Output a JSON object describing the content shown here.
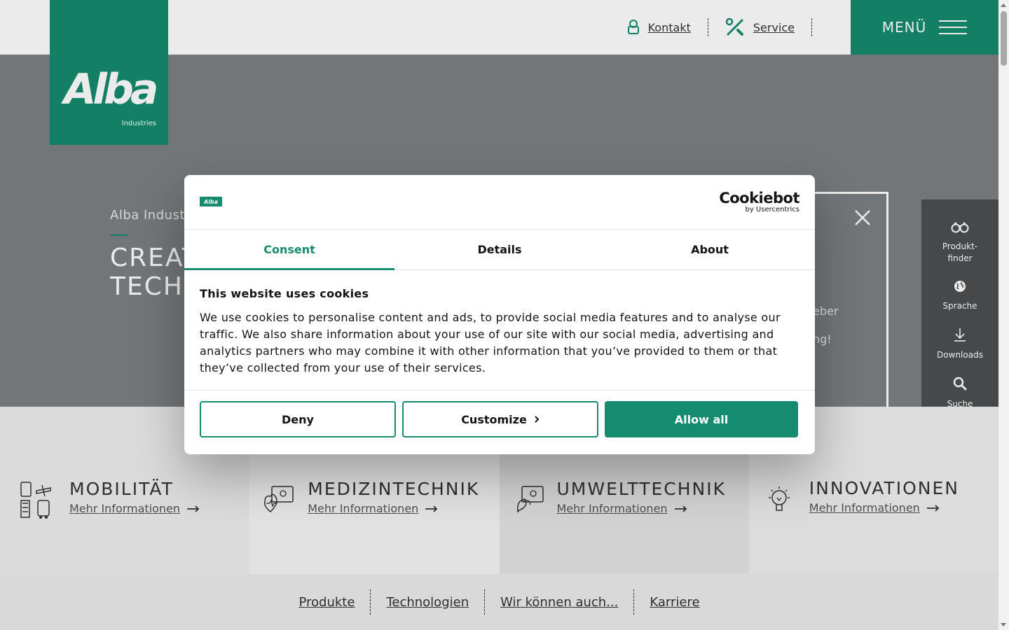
{
  "brand": {
    "logo_text": "Alba",
    "logo_sub": "Industries",
    "accent_color": "#158b6f"
  },
  "header": {
    "links": [
      {
        "label": "Kontakt",
        "icon": "user-icon"
      },
      {
        "label": "Service",
        "icon": "tools-icon"
      }
    ],
    "menu_label": "MENÜ"
  },
  "hero": {
    "kicker": "Alba Industr",
    "title_line1": "CREAT",
    "title_line2": "TECH",
    "panel_line1": "eber",
    "panel_line2": "ng!"
  },
  "sidetools": [
    {
      "label": "Produkt-\nfinder",
      "icon": "binoculars-icon"
    },
    {
      "label": "Sprache",
      "icon": "globe-icon"
    },
    {
      "label": "Downloads",
      "icon": "download-icon"
    },
    {
      "label": "Suche",
      "icon": "search-icon"
    }
  ],
  "sectors": [
    {
      "title": "MOBILITÄT",
      "link": "Mehr Informationen",
      "icon": "mobility-icon"
    },
    {
      "title": "MEDIZINTECHNIK",
      "link": "Mehr Informationen",
      "icon": "medical-icon"
    },
    {
      "title": "UMWELTTECHNIK",
      "link": "Mehr Informationen",
      "icon": "environment-icon"
    },
    {
      "title": "INNOVATIONEN",
      "link": "Mehr Informationen",
      "icon": "lightbulb-icon"
    }
  ],
  "bottomnav": [
    "Produkte",
    "Technologien",
    "Wir können auch...",
    "Karriere"
  ],
  "cookie": {
    "provider_name": "Cookiebot",
    "provider_by": "by Usercentrics",
    "modal_logo": "Alba",
    "tabs": [
      "Consent",
      "Details",
      "About"
    ],
    "active_tab": "Consent",
    "heading": "This website uses cookies",
    "body": "We use cookies to personalise content and ads, to provide social media features and to analyse our traffic. We also share information about your use of our site with our social media, advertising and analytics partners who may combine it with other information that you’ve provided to them or that they’ve collected from your use of their services.",
    "buttons": {
      "deny": "Deny",
      "customize": "Customize",
      "allow_all": "Allow all"
    }
  }
}
